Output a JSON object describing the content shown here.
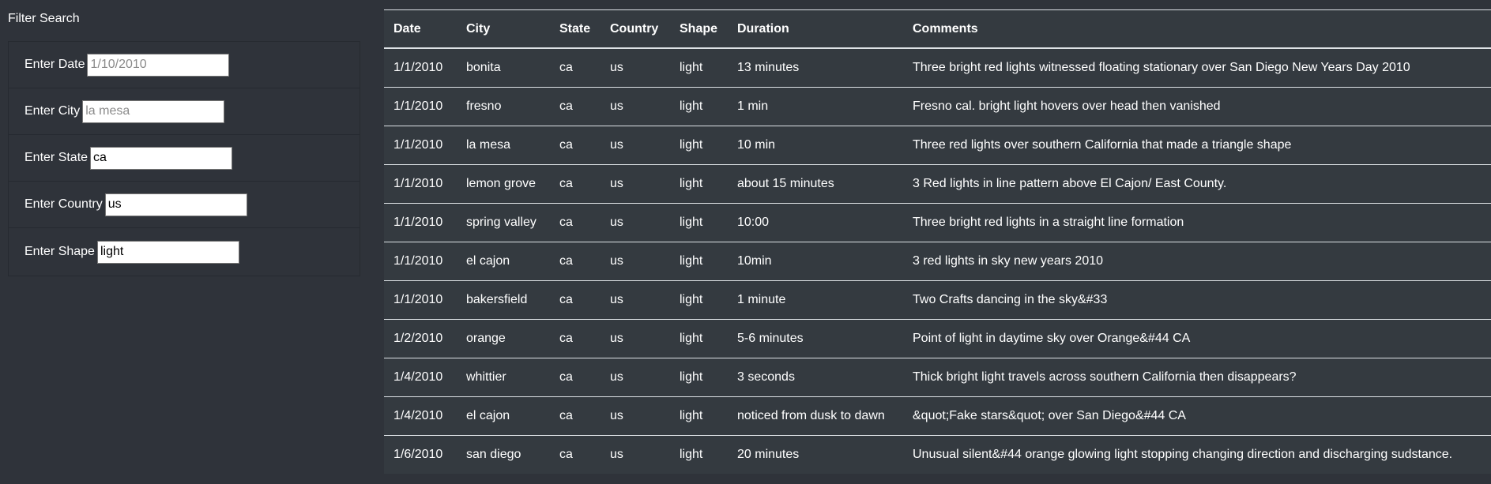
{
  "sidebar": {
    "title": "Filter Search",
    "filters": [
      {
        "label": "Enter Date",
        "value": "",
        "placeholder": "1/10/2010"
      },
      {
        "label": "Enter City",
        "value": "",
        "placeholder": "la mesa"
      },
      {
        "label": "Enter State",
        "value": "ca",
        "placeholder": ""
      },
      {
        "label": "Enter Country",
        "value": "us",
        "placeholder": ""
      },
      {
        "label": "Enter Shape",
        "value": "light",
        "placeholder": ""
      }
    ]
  },
  "table": {
    "headers": [
      "Date",
      "City",
      "State",
      "Country",
      "Shape",
      "Duration",
      "Comments"
    ],
    "rows": [
      [
        "1/1/2010",
        "bonita",
        "ca",
        "us",
        "light",
        "13 minutes",
        "Three bright red lights witnessed floating stationary over San Diego New Years Day 2010"
      ],
      [
        "1/1/2010",
        "fresno",
        "ca",
        "us",
        "light",
        "1 min",
        "Fresno cal. bright light hovers over head then vanished"
      ],
      [
        "1/1/2010",
        "la mesa",
        "ca",
        "us",
        "light",
        "10 min",
        "Three red lights over southern California that made a triangle shape"
      ],
      [
        "1/1/2010",
        "lemon grove",
        "ca",
        "us",
        "light",
        "about 15 minutes",
        "3 Red lights in line pattern above El Cajon/ East County."
      ],
      [
        "1/1/2010",
        "spring valley",
        "ca",
        "us",
        "light",
        "10:00",
        "Three bright red lights in a straight line formation"
      ],
      [
        "1/1/2010",
        "el cajon",
        "ca",
        "us",
        "light",
        "10min",
        "3 red lights in sky new years 2010"
      ],
      [
        "1/1/2010",
        "bakersfield",
        "ca",
        "us",
        "light",
        "1 minute",
        "Two Crafts dancing in the sky&#33"
      ],
      [
        "1/2/2010",
        "orange",
        "ca",
        "us",
        "light",
        "5-6 minutes",
        "Point of light in daytime sky over Orange&#44 CA"
      ],
      [
        "1/4/2010",
        "whittier",
        "ca",
        "us",
        "light",
        "3 seconds",
        "Thick bright light travels across southern California then disappears?"
      ],
      [
        "1/4/2010",
        "el cajon",
        "ca",
        "us",
        "light",
        "noticed from dusk to dawn",
        "&quot;Fake stars&quot; over San Diego&#44 CA"
      ],
      [
        "1/6/2010",
        "san diego",
        "ca",
        "us",
        "light",
        "20 minutes",
        "Unusual silent&#44 orange glowing light stopping changing direction and discharging sudstance."
      ]
    ]
  }
}
